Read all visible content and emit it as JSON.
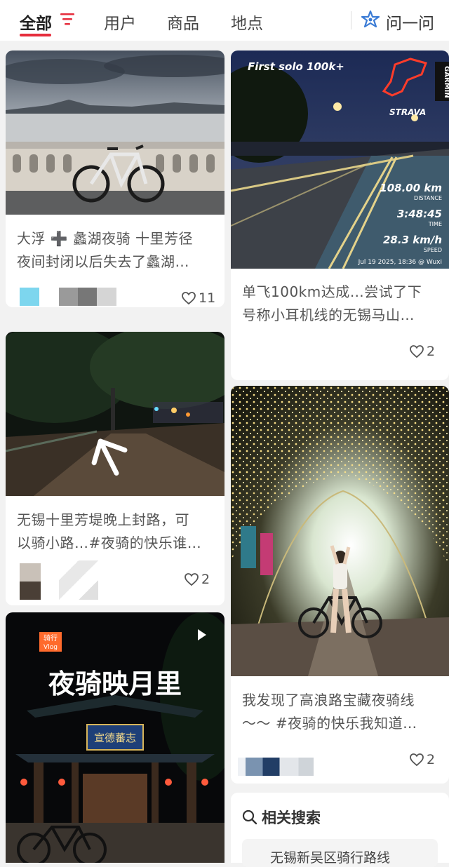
{
  "tabs": {
    "all": "全部",
    "users": "用户",
    "goods": "商品",
    "places": "地点",
    "ask": "问一问"
  },
  "colors": {
    "accent": "#e62d3c",
    "ask_blue": "#3a7bd5"
  },
  "cards": [
    {
      "id": "c1",
      "title_line1": "大浮 ➕ 蠡湖夜骑 十里芳径",
      "title_line2": "夜间封闭以后失去了蠡湖…",
      "likes": "11"
    },
    {
      "id": "c2",
      "title_line1": "单飞100km达成…尝试了下",
      "title_line2": "号称小耳机线的无锡马山…",
      "likes": "2",
      "overlay": {
        "headline": "First solo 100k+",
        "brand": "STRAVA",
        "watermark": "GARMIN",
        "distance": "108.00 km",
        "distance_label": "DISTANCE",
        "time": "3:48:45",
        "time_label": "TIME",
        "speed": "28.3 km/h",
        "speed_label": "SPEED",
        "timestamp": "Jul 19 2025, 18:36 @ Wuxi"
      }
    },
    {
      "id": "c3",
      "title_line1": "无锡十里芳堤晚上封路，可",
      "title_line2": "以骑小路…#夜骑的快乐谁…",
      "likes": "2"
    },
    {
      "id": "c4",
      "title_line1": "我发现了高浪路宝藏夜骑线",
      "title_line2": "～～ #夜骑的快乐我知道…",
      "likes": "2"
    },
    {
      "id": "c5",
      "badge_line1": "骑行",
      "badge_line2": "Vlog",
      "cover_text": "夜骑映月里",
      "sign_text": "宣德蕃志"
    }
  ],
  "related": {
    "title": "相关搜索",
    "item": "无锡新吴区骑行路线"
  }
}
